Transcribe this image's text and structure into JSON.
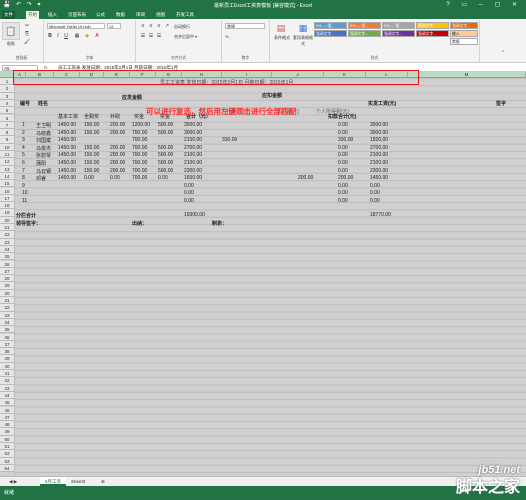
{
  "window": {
    "title": "最新员工Excel工资表模板 [兼容模式] - Excel",
    "qat": "💾 ↶ ↷ ▾",
    "controls": "? ▭ ─ ▢ ✕"
  },
  "tabs": [
    "文件",
    "开始",
    "插入",
    "页面布局",
    "公式",
    "数据",
    "审阅",
    "视图",
    "开发工具"
  ],
  "ribbon": {
    "paste": "粘贴",
    "cut": "✂",
    "copy": "⎘",
    "painter": "🖌",
    "font_name": "Microsoft YaHei UI Ligh",
    "font_size": "12",
    "group_clipboard": "剪贴板",
    "group_font": "字体",
    "group_align": "对齐方式",
    "group_number": "数字",
    "group_styles": "样式",
    "wrap": "自动换行",
    "merge": "合并后居中 ▾",
    "numfmt": "常规",
    "percent": "% ,",
    "cond": "条件格式",
    "table_fmt": "套用表格格式",
    "styles": [
      "0% — 强...",
      "0% — 强...",
      "0% — 强...",
      "强调文字...",
      "强调文字...",
      "强调文字...",
      "强调文字...",
      "强调文字...",
      "强调文字...",
      "输入",
      "常规"
    ]
  },
  "formula": {
    "namebox": "A5",
    "fx": "fx",
    "content": "员工工资表     发放日期：2015年2月1日 月薪日期：2015年1月"
  },
  "columns": [
    "A",
    "B",
    "C",
    "D",
    "E",
    "F",
    "G",
    "H",
    "I",
    "J",
    "K",
    "L",
    "M"
  ],
  "rows": [
    "1",
    "2",
    "3",
    "4",
    "5",
    "6",
    "7",
    "8",
    "9",
    "10",
    "11",
    "12",
    "13",
    "14",
    "15",
    "16",
    "17",
    "18",
    "19",
    "20",
    "21",
    "22",
    "23",
    "24",
    "25",
    "26",
    "27",
    "28",
    "29",
    "30",
    "31",
    "32",
    "33",
    "34",
    "35",
    "36",
    "37",
    "38",
    "39",
    "40",
    "41",
    "42",
    "43",
    "44",
    "45",
    "46",
    "47",
    "48",
    "49",
    "50",
    "51",
    "52",
    "53",
    "54"
  ],
  "title_row": "员工工资表     发放日期：2015年2月1日 月薪日期：2015年1月",
  "callout": "可以进行复选，然后用左键双击进行全部匹配",
  "headers": {
    "id": "编号",
    "name": "姓名",
    "payable": "应发金额",
    "deduct": "应扣金额",
    "net": "实发工资(元)",
    "sign": "签字",
    "base": "基本工资",
    "allowance": "全勤奖",
    "subsidy": "补助",
    "bonus": "奖金",
    "total": "合计（元）",
    "d1": "社保(元)",
    "d2": "公积金(元)",
    "d3": "个人所得税(元)",
    "dtotal": "扣款合计(元)"
  },
  "table": [
    {
      "id": "1",
      "name": "王卫明",
      "base": "1450.00",
      "att": "150.00",
      "sub": "200.00",
      "bonus": "1200.00",
      "extra": "500.00",
      "total": "3500.00",
      "x": "",
      "y": "",
      "dt": "0.00",
      "net": "3500.00"
    },
    {
      "id": "2",
      "name": "马晓鑫",
      "base": "1450.00",
      "att": "150.00",
      "sub": "200.00",
      "bonus": "700.00",
      "extra": "500.00",
      "total": "3000.00",
      "x": "",
      "y": "",
      "dt": "0.00",
      "net": "3000.00"
    },
    {
      "id": "3",
      "name": "刘国斌",
      "base": "1450.00",
      "att": "",
      "sub": "",
      "bonus": "700.00",
      "extra": "",
      "total": "2150.00",
      "x": "330.00",
      "y": "",
      "dt": "330.00",
      "net": "1820.00"
    },
    {
      "id": "4",
      "name": "马俊杰",
      "base": "1450.00",
      "att": "150.00",
      "sub": "200.00",
      "bonus": "700.00",
      "extra": "500.00",
      "total": "2700.00",
      "x": "",
      "y": "",
      "dt": "0.00",
      "net": "2700.00"
    },
    {
      "id": "5",
      "name": "张碧琴",
      "base": "1450.00",
      "att": "150.00",
      "sub": "200.00",
      "bonus": "700.00",
      "extra": "500.00",
      "total": "2100.00",
      "x": "",
      "y": "",
      "dt": "0.00",
      "net": "2100.00"
    },
    {
      "id": "6",
      "name": "蒲阳",
      "base": "1450.00",
      "att": "150.00",
      "sub": "200.00",
      "bonus": "700.00",
      "extra": "500.00",
      "total": "2100.00",
      "x": "",
      "y": "",
      "dt": "0.00",
      "net": "2100.00"
    },
    {
      "id": "7",
      "name": "马云钢",
      "base": "1450.00",
      "att": "150.00",
      "sub": "200.00",
      "bonus": "700.00",
      "extra": "500.00",
      "total": "2300.00",
      "x": "",
      "y": "",
      "dt": "0.00",
      "net": "2300.00"
    },
    {
      "id": "8",
      "name": "邓睿",
      "base": "1450.00",
      "att": "0.00",
      "sub": "0.00",
      "bonus": "700.00",
      "extra": "0.00",
      "total": "1650.00",
      "x": "",
      "y": "200.00",
      "dt": "200.00",
      "net": "1450.00"
    },
    {
      "id": "9",
      "name": "",
      "base": "",
      "att": "",
      "sub": "",
      "bonus": "",
      "extra": "",
      "total": "0.00",
      "x": "",
      "y": "",
      "dt": "0.00",
      "net": "0.00"
    },
    {
      "id": "10",
      "name": "",
      "base": "",
      "att": "",
      "sub": "",
      "bonus": "",
      "extra": "",
      "total": "0.00",
      "x": "",
      "y": "",
      "dt": "0.00",
      "net": "0.00"
    },
    {
      "id": "11",
      "name": "",
      "base": "",
      "att": "",
      "sub": "",
      "bonus": "",
      "extra": "",
      "total": "0.00",
      "x": "",
      "y": "",
      "dt": "0.00",
      "net": "0.00"
    }
  ],
  "subtotal": {
    "label": "分栏合计",
    "total": "19300.00",
    "net": "18770.00"
  },
  "footer": {
    "leader": "领导签字：",
    "cashier": "出纳：",
    "maker": "制表："
  },
  "sheet_tabs": [
    "5月工资",
    "Sheet3"
  ],
  "add_sheet": "⊕",
  "status": {
    "text": "就绪"
  },
  "watermark": {
    "site": "jb51.net",
    "name": "脚本之家"
  }
}
